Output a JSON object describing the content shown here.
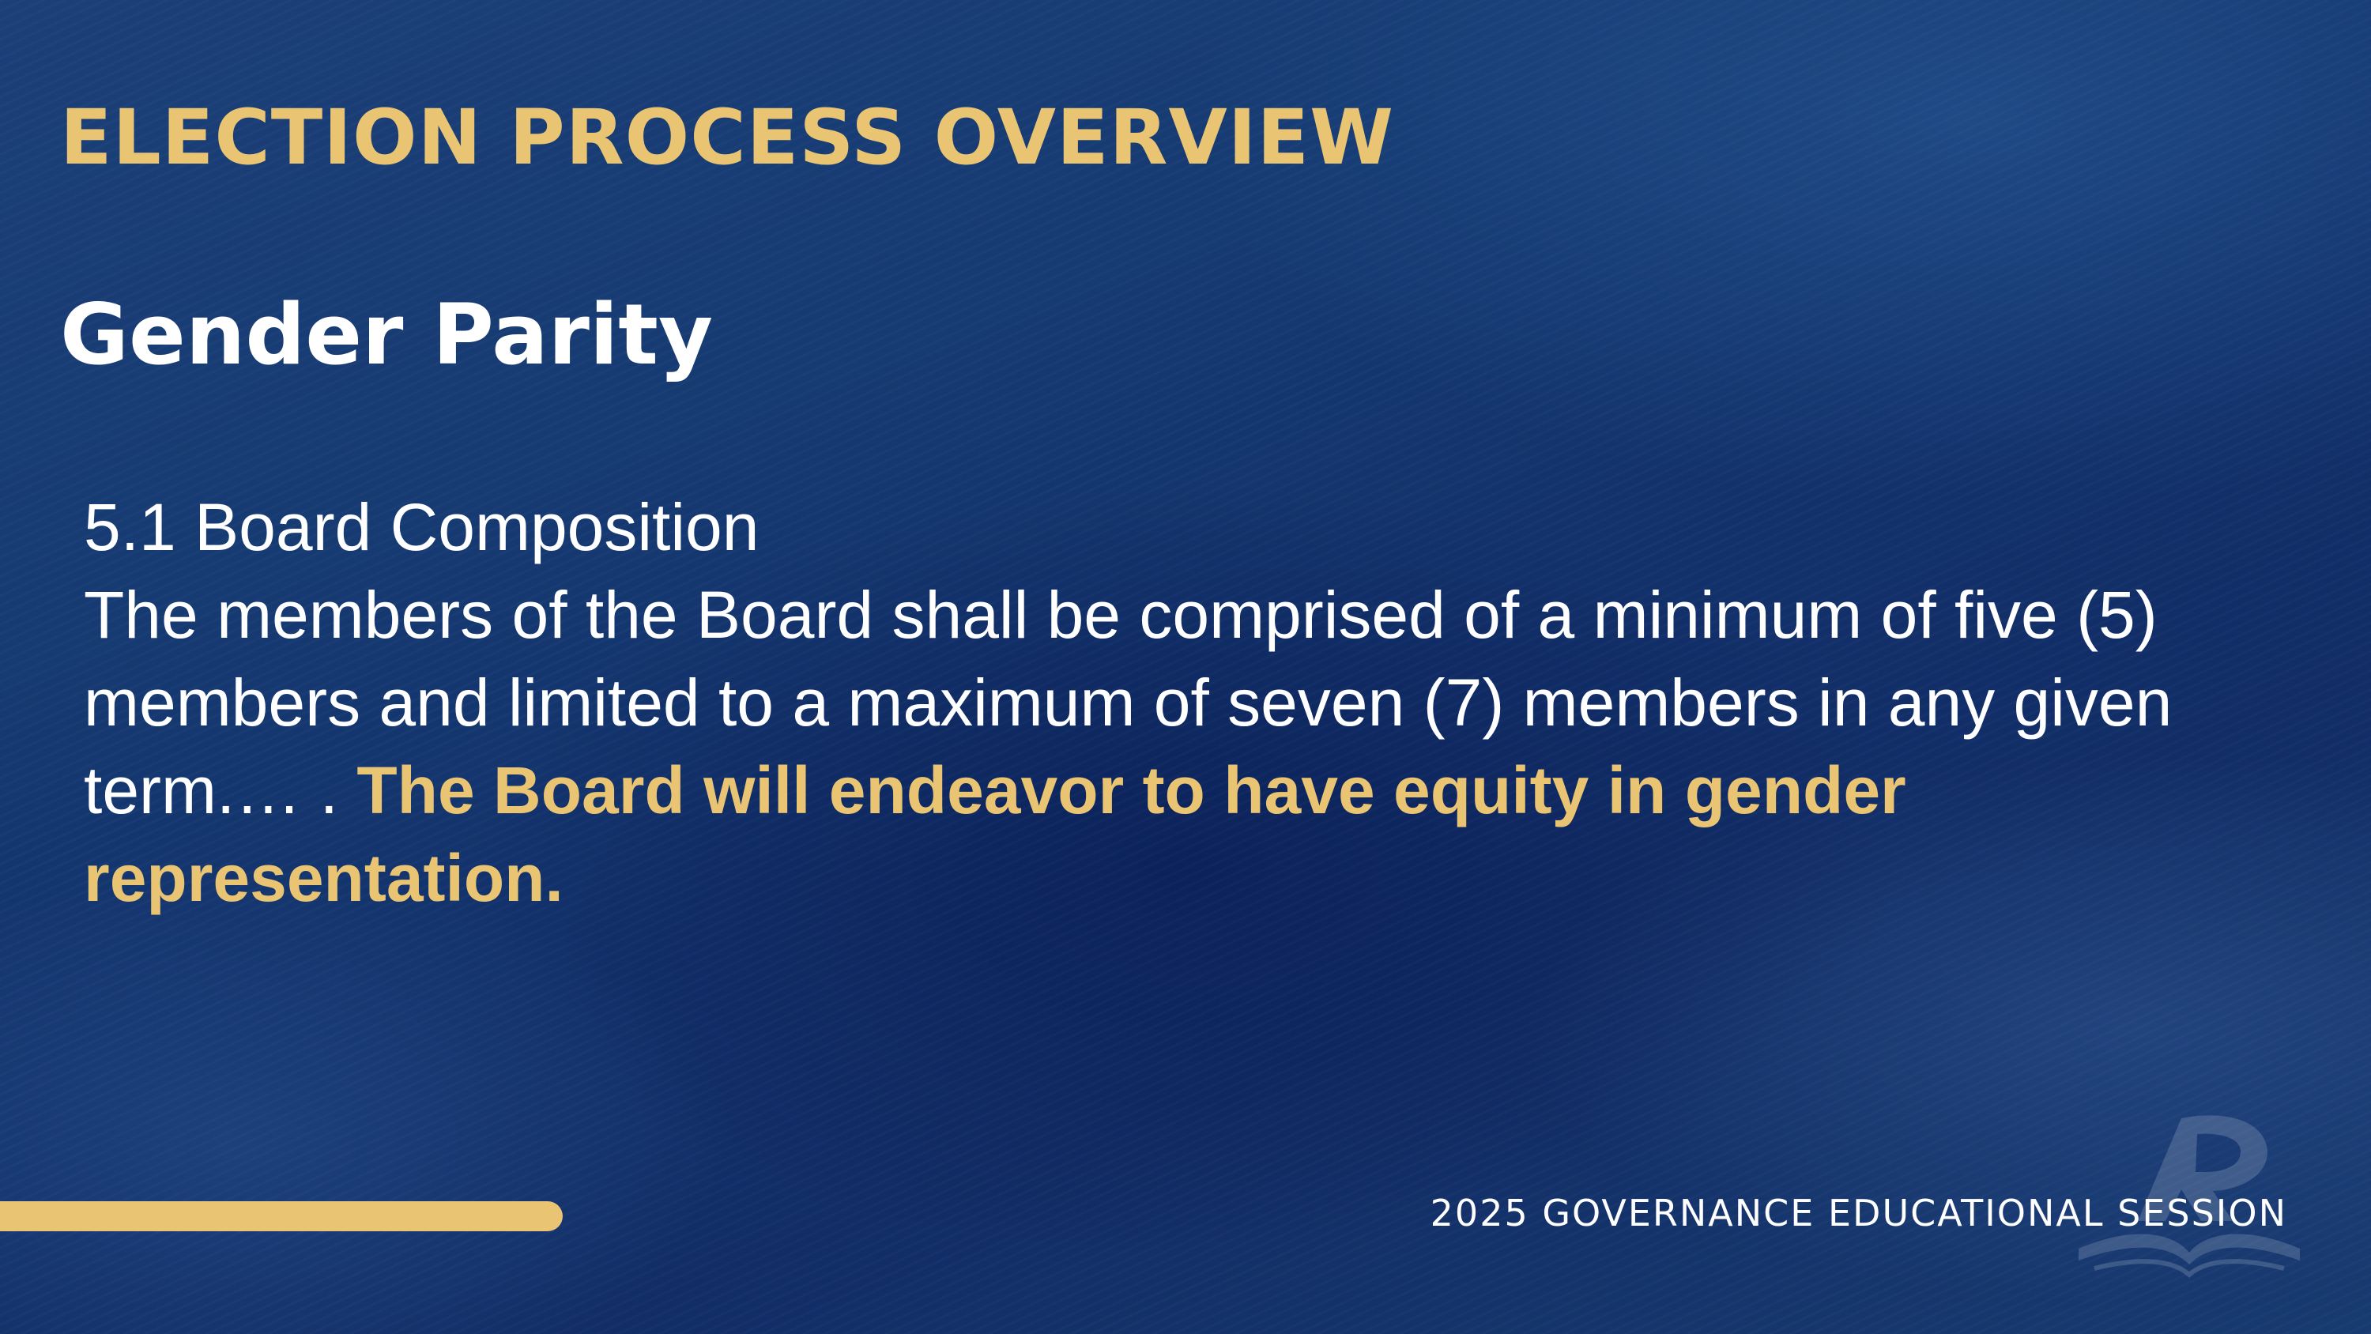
{
  "slide": {
    "heading": "ELECTION PROCESS OVERVIEW",
    "subheading": "Gender Parity",
    "section_title": "5.1 Board Composition",
    "body_text": "The members of the Board shall be comprised of a minimum of five (5) members and limited to a maximum of seven (7) members in any given term.… .",
    "highlight_text": "The Board will endeavor to have equity in gender representation.",
    "footer": "2025 GOVERNANCE EDUCATIONAL SESSION"
  },
  "colors": {
    "background": "#13306b",
    "accent": "#e9c473",
    "text": "#ffffff"
  },
  "icons": {
    "logo": "organization-logo-watermark"
  }
}
